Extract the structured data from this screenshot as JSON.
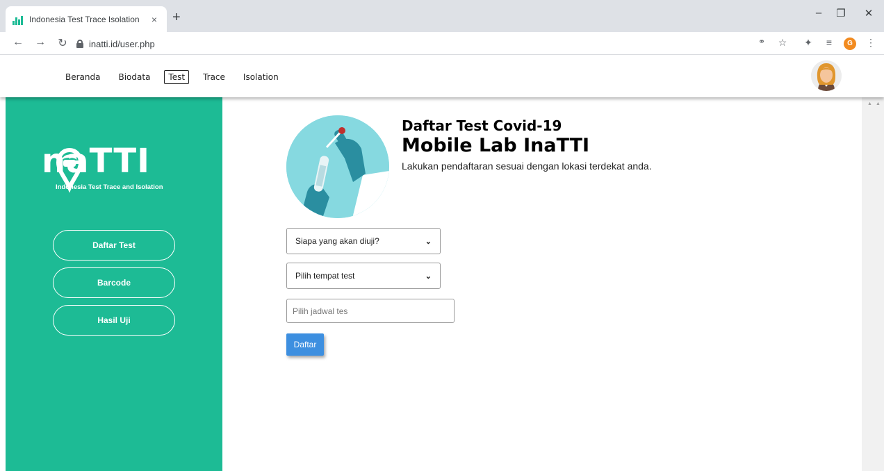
{
  "browser": {
    "tab_title": "Indonesia Test Trace Isolation",
    "tab_close": "×",
    "new_tab": "+",
    "url": "inatti.id/user.php",
    "profile_initial": "G",
    "window_controls": {
      "minimize": "–",
      "restore": "❐",
      "close": "✕"
    }
  },
  "nav": {
    "items": [
      {
        "label": "Beranda"
      },
      {
        "label": "Biodata"
      },
      {
        "label": "Test"
      },
      {
        "label": "Trace"
      },
      {
        "label": "Isolation"
      }
    ],
    "active": "Test"
  },
  "sidebar": {
    "logo_text": "naTTI",
    "logo_subtitle": "Indonesia Test Trace and Isolation",
    "buttons": [
      {
        "label": "Daftar Test"
      },
      {
        "label": "Barcode"
      },
      {
        "label": "Hasil Uji"
      }
    ]
  },
  "main": {
    "title": "Daftar Test Covid-19",
    "heading": "Mobile Lab InaTTI",
    "subtitle": "Lakukan pendaftaran sesuai dengan lokasi terdekat anda.",
    "select_person": "Siapa yang akan diuji?",
    "select_place": "Pilih tempat test",
    "schedule_placeholder": "Pilih jadwal tes",
    "submit_label": "Daftar"
  },
  "colors": {
    "sidebar": "#1dbb95",
    "button": "#3d8fe0",
    "hero_bg": "#86d9e0"
  }
}
